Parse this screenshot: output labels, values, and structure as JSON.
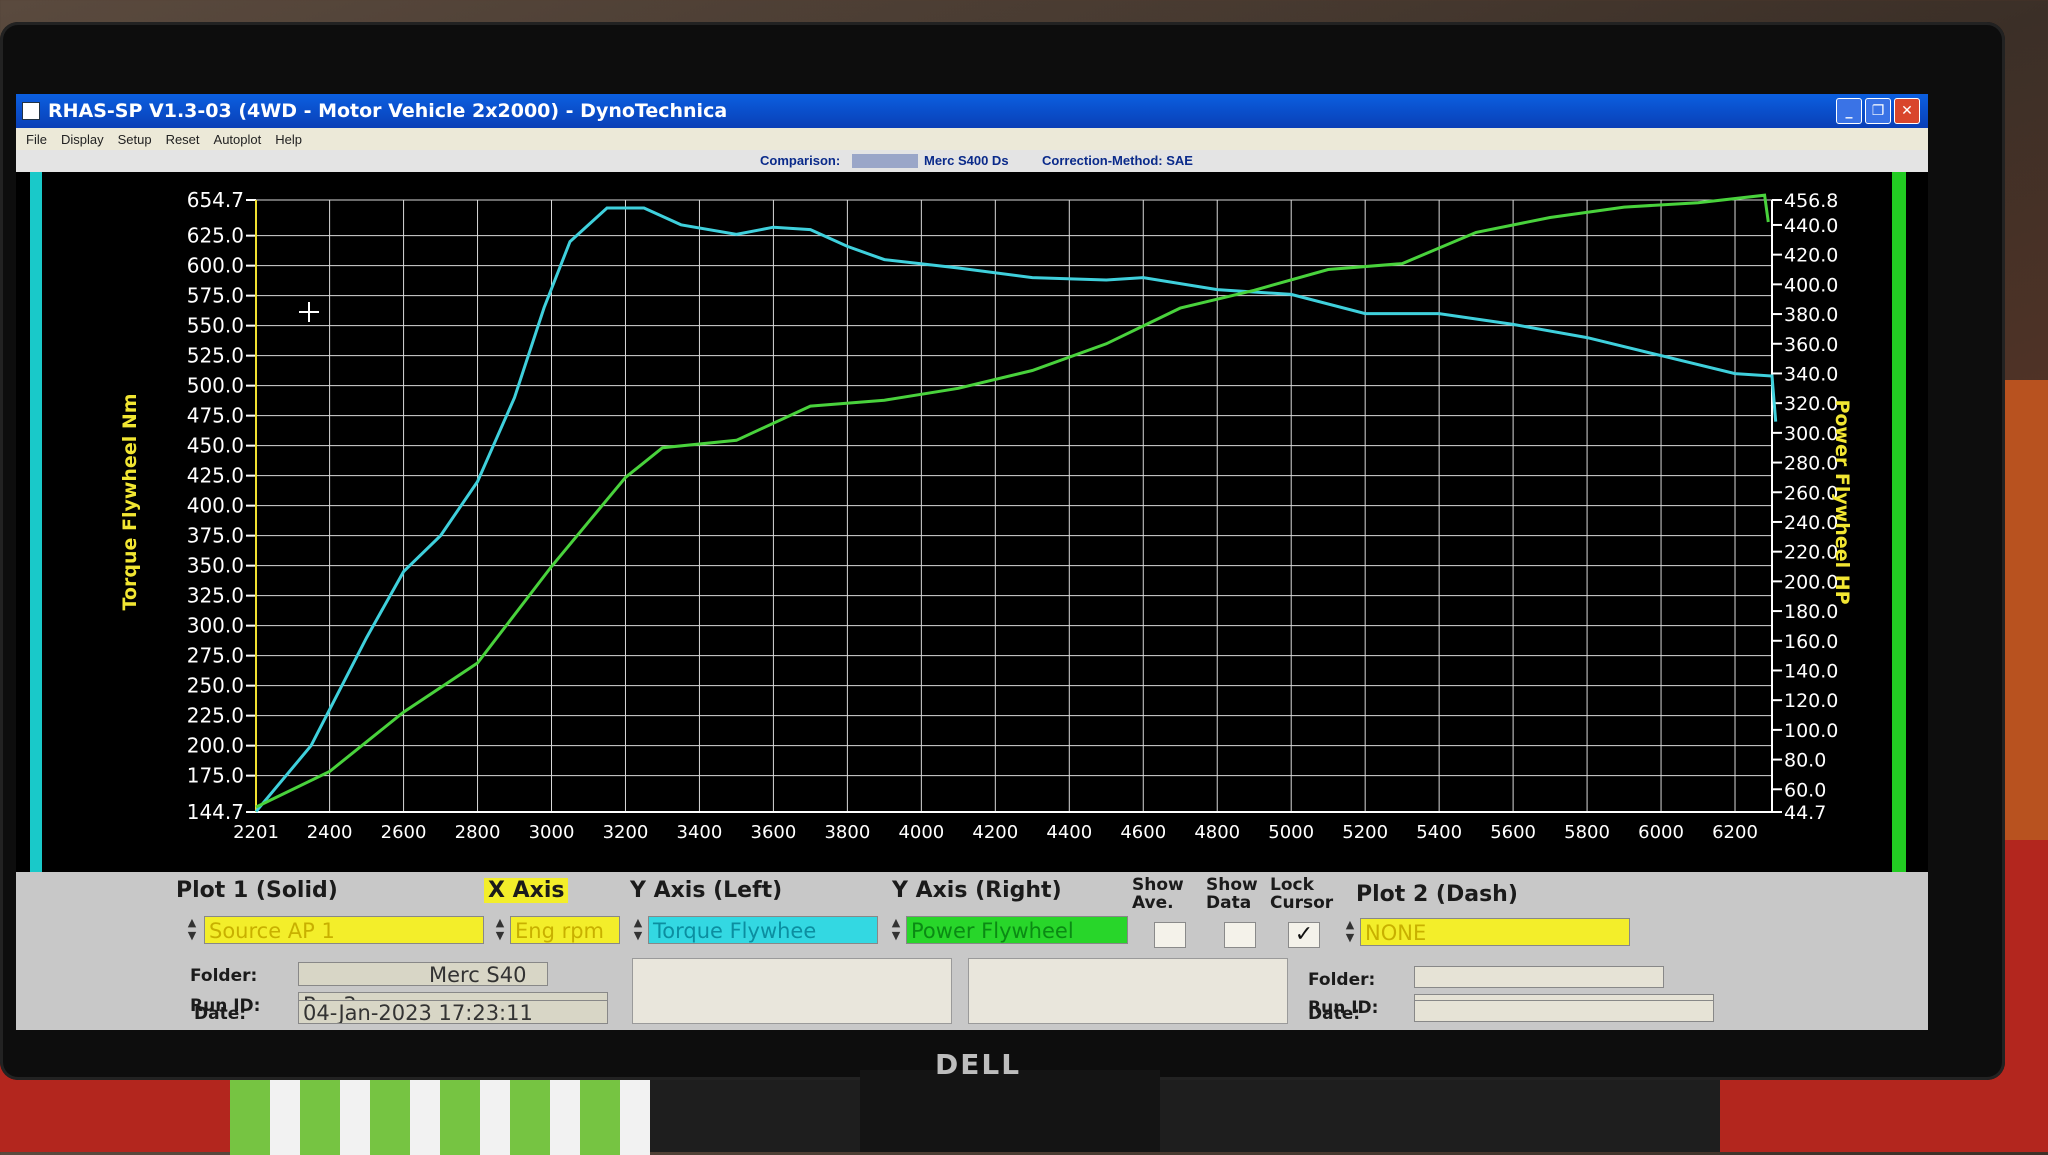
{
  "window": {
    "title": "RHAS-SP V1.3-03  (4WD - Motor Vehicle 2x2000) - DynoTechnica",
    "menu": [
      "File",
      "Display",
      "Setup",
      "Reset",
      "Autoplot",
      "Help"
    ],
    "buttons": {
      "minimize": "_",
      "restore": "❐",
      "close": "✕"
    }
  },
  "infobar": {
    "comparison_label": "Comparison:",
    "comparison_value": "Merc S400 Ds",
    "correction": "Correction-Method: SAE"
  },
  "chart_data": {
    "type": "line",
    "x": {
      "label": "",
      "min": 2201,
      "max": 6300,
      "ticks": [
        "2201",
        "2400",
        "2600",
        "2800",
        "3000",
        "3200",
        "3400",
        "3600",
        "3800",
        "4000",
        "4200",
        "4400",
        "4600",
        "4800",
        "5000",
        "5200",
        "5400",
        "5600",
        "5800",
        "6000",
        "6200"
      ]
    },
    "y_left": {
      "label": "Torque Flywheel Nm",
      "min": 144.7,
      "max": 654.7,
      "ticks": [
        "654.7",
        "625.0",
        "600.0",
        "575.0",
        "550.0",
        "525.0",
        "500.0",
        "475.0",
        "450.0",
        "425.0",
        "400.0",
        "375.0",
        "350.0",
        "325.0",
        "300.0",
        "275.0",
        "250.0",
        "225.0",
        "200.0",
        "175.0",
        "144.7"
      ]
    },
    "y_right": {
      "label": "Power Flywheel HP",
      "min": 44.7,
      "max": 456.8,
      "ticks": [
        "456.8",
        "440.0",
        "420.0",
        "400.0",
        "380.0",
        "360.0",
        "340.0",
        "320.0",
        "300.0",
        "280.0",
        "260.0",
        "240.0",
        "220.0",
        "200.0",
        "180.0",
        "160.0",
        "140.0",
        "120.0",
        "100.0",
        "80.0",
        "60.0",
        "44.7"
      ]
    },
    "grid": true,
    "series": [
      {
        "name": "Torque Flywheel",
        "axis": "left",
        "color": "#3fd0dc",
        "points": [
          [
            2201,
            145
          ],
          [
            2350,
            200
          ],
          [
            2500,
            290
          ],
          [
            2600,
            345
          ],
          [
            2700,
            375
          ],
          [
            2800,
            420
          ],
          [
            2900,
            490
          ],
          [
            2980,
            565
          ],
          [
            3050,
            620
          ],
          [
            3150,
            648
          ],
          [
            3250,
            648
          ],
          [
            3350,
            634
          ],
          [
            3500,
            626
          ],
          [
            3600,
            632
          ],
          [
            3700,
            630
          ],
          [
            3800,
            616
          ],
          [
            3900,
            605
          ],
          [
            4100,
            598
          ],
          [
            4300,
            590
          ],
          [
            4500,
            588
          ],
          [
            4600,
            590
          ],
          [
            4800,
            580
          ],
          [
            5000,
            576
          ],
          [
            5200,
            560
          ],
          [
            5400,
            560
          ],
          [
            5600,
            551
          ],
          [
            5800,
            540
          ],
          [
            6000,
            525
          ],
          [
            6200,
            510
          ],
          [
            6300,
            508
          ],
          [
            6310,
            470
          ]
        ]
      },
      {
        "name": "Power Flywheel",
        "axis": "right",
        "color": "#49d23c",
        "points": [
          [
            2201,
            48
          ],
          [
            2400,
            72
          ],
          [
            2600,
            112
          ],
          [
            2800,
            145
          ],
          [
            3000,
            210
          ],
          [
            3200,
            270
          ],
          [
            3300,
            290
          ],
          [
            3500,
            295
          ],
          [
            3700,
            318
          ],
          [
            3900,
            322
          ],
          [
            4100,
            330
          ],
          [
            4300,
            342
          ],
          [
            4500,
            360
          ],
          [
            4700,
            384
          ],
          [
            4900,
            396
          ],
          [
            5100,
            410
          ],
          [
            5300,
            414
          ],
          [
            5500,
            435
          ],
          [
            5700,
            445
          ],
          [
            5900,
            452
          ],
          [
            6100,
            455
          ],
          [
            6280,
            460
          ],
          [
            6290,
            442
          ]
        ]
      }
    ]
  },
  "panel": {
    "plot1_title": "Plot 1 (Solid)",
    "xaxis_title": "X Axis",
    "yleft_title": "Y Axis (Left)",
    "yright_title": "Y Axis (Right)",
    "show_ave": "Show Ave.",
    "show_data": "Show Data",
    "lock_cursor": "Lock Cursor",
    "plot2_title": "Plot 2 (Dash)",
    "source": "Source AP 1",
    "xaxis_value": "Eng rpm",
    "yleft_value": "Torque Flywhee",
    "yright_value": "Power Flywheel",
    "plot2_value": "NONE",
    "folder_label": "Folder:",
    "folder_value": "Merc S40",
    "runid_label": "Run ID:",
    "runid_value": "Run3",
    "date_label": "Date:",
    "date_value": "04-Jan-2023  17:23:11",
    "lock_cursor_checked": "✓",
    "plot2_folder_label": "Folder:",
    "plot2_runid_label": "Run ID:",
    "plot2_date_label": "Date:"
  },
  "monitor_brand": "DELL"
}
